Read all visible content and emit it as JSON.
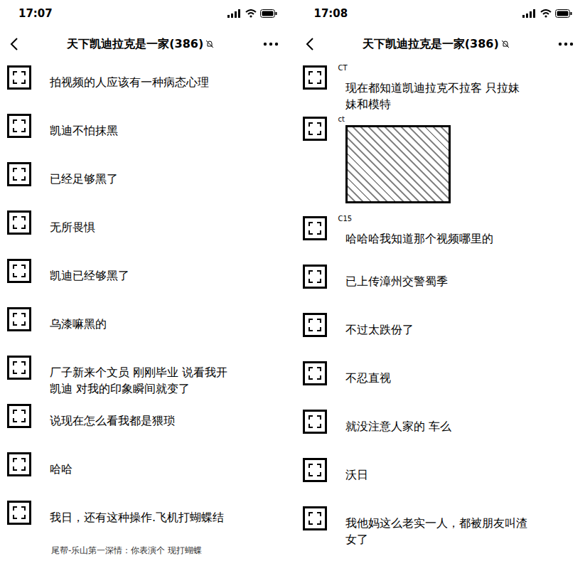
{
  "screens": [
    {
      "status_bar": {
        "time": "17:07"
      },
      "title": "天下凯迪拉克是一家(386)",
      "messages": [
        {
          "kind": "text",
          "text": "拍视频的人应该有一种病态心理"
        },
        {
          "kind": "text",
          "text": "凯迪不怕抹黑"
        },
        {
          "kind": "text",
          "text": "已经足够黑了"
        },
        {
          "kind": "text",
          "text": "无所畏惧"
        },
        {
          "kind": "text",
          "text": "凯迪已经够黑了"
        },
        {
          "kind": "text",
          "text": "乌漆嘛黑的"
        },
        {
          "kind": "text",
          "text": "厂子新来个文员 刚刚毕业 说看我开凯迪 对我的印象瞬间就变了"
        },
        {
          "kind": "text",
          "text": "说现在怎么看我都是猥琐"
        },
        {
          "kind": "text",
          "text": "哈哈"
        },
        {
          "kind": "text",
          "text": "我日，还有这种操作.飞机打蝴蝶结"
        },
        {
          "kind": "quote",
          "text": "尾帮-乐山第一深情：你表演个 现打蝴蝶"
        }
      ]
    },
    {
      "status_bar": {
        "time": "17:08"
      },
      "title": "天下凯迪拉克是一家(386)",
      "messages": [
        {
          "kind": "text",
          "sender": "CT",
          "text": "现在都知道凯迪拉克不拉客 只拉妹妹和模特"
        },
        {
          "kind": "image",
          "sender": "ct"
        },
        {
          "kind": "text",
          "sender": "C15",
          "text": "哈哈哈我知道那个视频哪里的"
        },
        {
          "kind": "text",
          "text": "已上传漳州交警蜀季"
        },
        {
          "kind": "text",
          "text": "不过太跌份了"
        },
        {
          "kind": "text",
          "text": "不忍直视"
        },
        {
          "kind": "text",
          "text": "就没注意人家的 车么"
        },
        {
          "kind": "text",
          "text": "沃日"
        },
        {
          "kind": "text",
          "text": "我他妈这么老实一人，都被朋友叫渣女了"
        }
      ]
    }
  ]
}
